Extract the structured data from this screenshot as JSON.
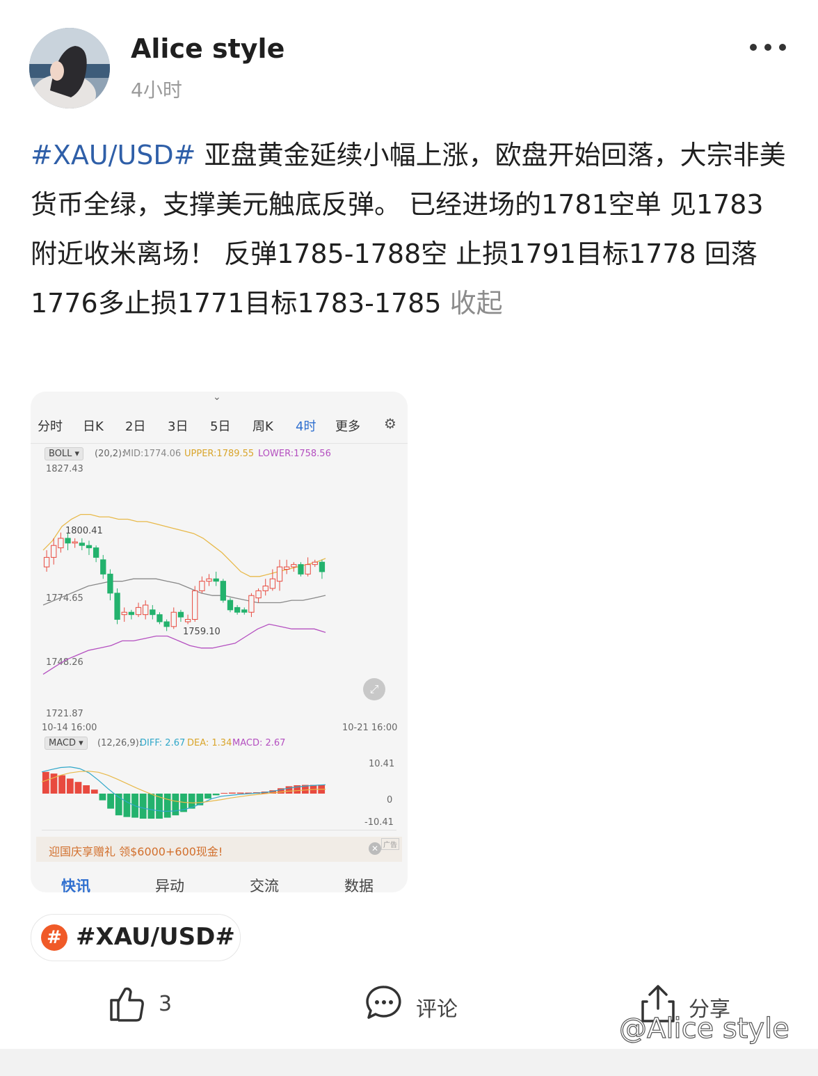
{
  "post": {
    "author": "Alice style",
    "time": "4小时",
    "hashtag": "#XAU/USD#",
    "body": " 亚盘黄金延续小幅上涨，欧盘开始回落，大宗非美货币全绿，支撑美元触底反弹。 已经进场的1781空单 见1783附近收米离场！ 反弹1785-1788空 止损1791目标1778 回落1776多止损1771目标1783-1785 ",
    "collapse_label": "收起"
  },
  "screenshot": {
    "tabs": [
      "分时",
      "日K",
      "2日",
      "3日",
      "5日",
      "周K",
      "4时",
      "更多"
    ],
    "active_tab": "4时",
    "boll": {
      "select": "BOLL",
      "params": "(20,2):",
      "mid": "MID:1774.06",
      "upper": "UPPER:1789.55",
      "lower": "LOWER:1758.56"
    },
    "price_axis": {
      "top": "1827.43",
      "p2": "1800.41",
      "p3": "1774.65",
      "p4": "1748.26",
      "bottom": "1721.87",
      "low_mark": "1759.10"
    },
    "dates": {
      "start": "10-14 16:00",
      "end": "10-21 16:00"
    },
    "macd": {
      "select": "MACD",
      "params": "(12,26,9):",
      "diff": "DIFF: 2.67",
      "dea": "DEA: 1.34",
      "macd": "MACD: 2.67",
      "axis_top": "10.41",
      "axis_mid": "0",
      "axis_bottom": "-10.41"
    },
    "ad": {
      "text": "迎国庆享赠礼 领$6000+600现金!",
      "tag": "广告"
    },
    "bottom_tabs": [
      "快讯",
      "异动",
      "交流",
      "数据"
    ]
  },
  "topic": {
    "label": "#XAU/USD#"
  },
  "actions": {
    "like_count": "3",
    "comment_label": "评论",
    "share_label": "分享"
  },
  "watermark": "@Alice style",
  "colors": {
    "hashtag": "#2f5fa8",
    "up": "#e84a3f",
    "down": "#23b26d",
    "upper": "#e8b94a",
    "lower": "#b44fc0",
    "mid": "#888888",
    "topic_icon": "#f05a28"
  },
  "chart_data": [
    {
      "type": "candlestick",
      "title": "",
      "indicator": "BOLL (20,2)",
      "ylim": [
        1721.87,
        1827.43
      ],
      "x_start": "10-14 16:00",
      "x_end": "10-21 16:00",
      "candles": [
        {
          "o": 1786,
          "c": 1790,
          "h": 1793,
          "l": 1784
        },
        {
          "o": 1790,
          "c": 1795,
          "h": 1798,
          "l": 1787
        },
        {
          "o": 1794,
          "c": 1798,
          "h": 1800.41,
          "l": 1792
        },
        {
          "o": 1798,
          "c": 1796,
          "h": 1800,
          "l": 1793
        },
        {
          "o": 1796,
          "c": 1796.5,
          "h": 1798,
          "l": 1794
        },
        {
          "o": 1796,
          "c": 1795,
          "h": 1798,
          "l": 1793
        },
        {
          "o": 1795,
          "c": 1794,
          "h": 1797,
          "l": 1791
        },
        {
          "o": 1794,
          "c": 1790,
          "h": 1795,
          "l": 1788
        },
        {
          "o": 1789,
          "c": 1783,
          "h": 1791,
          "l": 1781
        },
        {
          "o": 1783,
          "c": 1775,
          "h": 1785,
          "l": 1772
        },
        {
          "o": 1775,
          "c": 1764,
          "h": 1777,
          "l": 1762
        },
        {
          "o": 1766,
          "c": 1767,
          "h": 1769,
          "l": 1763
        },
        {
          "o": 1767,
          "c": 1766,
          "h": 1768,
          "l": 1764
        },
        {
          "o": 1766,
          "c": 1769,
          "h": 1771,
          "l": 1765
        },
        {
          "o": 1766,
          "c": 1770,
          "h": 1772,
          "l": 1764
        },
        {
          "o": 1768,
          "c": 1766,
          "h": 1770,
          "l": 1764
        },
        {
          "o": 1766,
          "c": 1763,
          "h": 1767,
          "l": 1762
        },
        {
          "o": 1763,
          "c": 1761,
          "h": 1764,
          "l": 1759.1
        },
        {
          "o": 1761,
          "c": 1767,
          "h": 1769,
          "l": 1760
        },
        {
          "o": 1767,
          "c": 1765,
          "h": 1768,
          "l": 1763
        },
        {
          "o": 1763,
          "c": 1764,
          "h": 1766,
          "l": 1762
        },
        {
          "o": 1764,
          "c": 1776,
          "h": 1778,
          "l": 1763
        },
        {
          "o": 1776,
          "c": 1780,
          "h": 1782,
          "l": 1775
        },
        {
          "o": 1780,
          "c": 1781,
          "h": 1783,
          "l": 1778
        },
        {
          "o": 1781,
          "c": 1780,
          "h": 1784,
          "l": 1778
        },
        {
          "o": 1780,
          "c": 1772,
          "h": 1781,
          "l": 1771
        },
        {
          "o": 1772,
          "c": 1768,
          "h": 1773,
          "l": 1767
        },
        {
          "o": 1769,
          "c": 1767,
          "h": 1770,
          "l": 1766
        },
        {
          "o": 1768,
          "c": 1767,
          "h": 1769,
          "l": 1766
        },
        {
          "o": 1767,
          "c": 1774,
          "h": 1775,
          "l": 1765
        },
        {
          "o": 1773,
          "c": 1776,
          "h": 1777,
          "l": 1771
        },
        {
          "o": 1776,
          "c": 1778,
          "h": 1781,
          "l": 1774
        },
        {
          "o": 1777,
          "c": 1781,
          "h": 1785,
          "l": 1776
        },
        {
          "o": 1780,
          "c": 1786,
          "h": 1789,
          "l": 1776
        },
        {
          "o": 1785,
          "c": 1786,
          "h": 1789,
          "l": 1783
        },
        {
          "o": 1786,
          "c": 1787,
          "h": 1788,
          "l": 1784
        },
        {
          "o": 1787,
          "c": 1783,
          "h": 1788,
          "l": 1782
        },
        {
          "o": 1783,
          "c": 1787,
          "h": 1790,
          "l": 1782
        },
        {
          "o": 1787,
          "c": 1788,
          "h": 1789,
          "l": 1786
        },
        {
          "o": 1788,
          "c": 1784,
          "h": 1789,
          "l": 1781
        }
      ],
      "upper": [
        1793,
        1797,
        1803,
        1806,
        1808,
        1808,
        1807,
        1807,
        1806,
        1806,
        1805,
        1805,
        1804,
        1803,
        1802,
        1801,
        1800,
        1798,
        1795,
        1792,
        1788,
        1784,
        1782,
        1782,
        1783,
        1784,
        1785,
        1786,
        1787,
        1788,
        1789.55
      ],
      "mid": [
        1770,
        1772,
        1774,
        1776,
        1778,
        1779,
        1780,
        1780,
        1781,
        1781,
        1781,
        1780,
        1779,
        1777,
        1775,
        1774,
        1774,
        1773,
        1772,
        1771,
        1771,
        1771,
        1772,
        1772,
        1773,
        1774.06
      ],
      "lower": [
        1741,
        1744,
        1747,
        1749,
        1751,
        1752,
        1753,
        1755,
        1755,
        1756,
        1757,
        1757,
        1755,
        1753,
        1752,
        1752,
        1753,
        1754,
        1757,
        1760,
        1762,
        1761,
        1760,
        1760,
        1760,
        1758.56
      ]
    },
    {
      "type": "bar",
      "title": "",
      "indicator": "MACD (12,26,9)",
      "ylim": [
        -10.41,
        10.41
      ],
      "values": [
        6.5,
        6.0,
        5.5,
        4.5,
        3.5,
        2.5,
        1.2,
        -2,
        -4.5,
        -6.5,
        -7,
        -7.2,
        -7.5,
        -7.5,
        -7.5,
        -7.2,
        -6.5,
        -5.5,
        -4.5,
        -3.5,
        -1.5,
        -0.5,
        0.2,
        0.3,
        0.3,
        0.3,
        0.4,
        0.6,
        1.0,
        1.6,
        2.2,
        2.5,
        2.6,
        2.6,
        2.67
      ],
      "diff": [
        6.5,
        7.2,
        7.8,
        8.0,
        7.5,
        6.2,
        4.0,
        1.5,
        -0.8,
        -2.5,
        -3.8,
        -4.5,
        -5.0,
        -5.3,
        -5.2,
        -4.8,
        -4.0,
        -2.8,
        -1.5,
        -0.8,
        -0.5,
        -0.2,
        0,
        0.2,
        0.5,
        1.0,
        1.6,
        2.0,
        2.3,
        2.5,
        2.67
      ],
      "dea": [
        3.5,
        4.5,
        5.5,
        6.2,
        6.6,
        6.7,
        6.4,
        5.5,
        4.3,
        3.0,
        1.7,
        0.5,
        -0.6,
        -1.5,
        -2.2,
        -2.6,
        -2.8,
        -2.6,
        -2.2,
        -1.8,
        -1.3,
        -0.9,
        -0.5,
        -0.2,
        0.1,
        0.4,
        0.7,
        0.9,
        1.1,
        1.3,
        1.34
      ]
    }
  ]
}
